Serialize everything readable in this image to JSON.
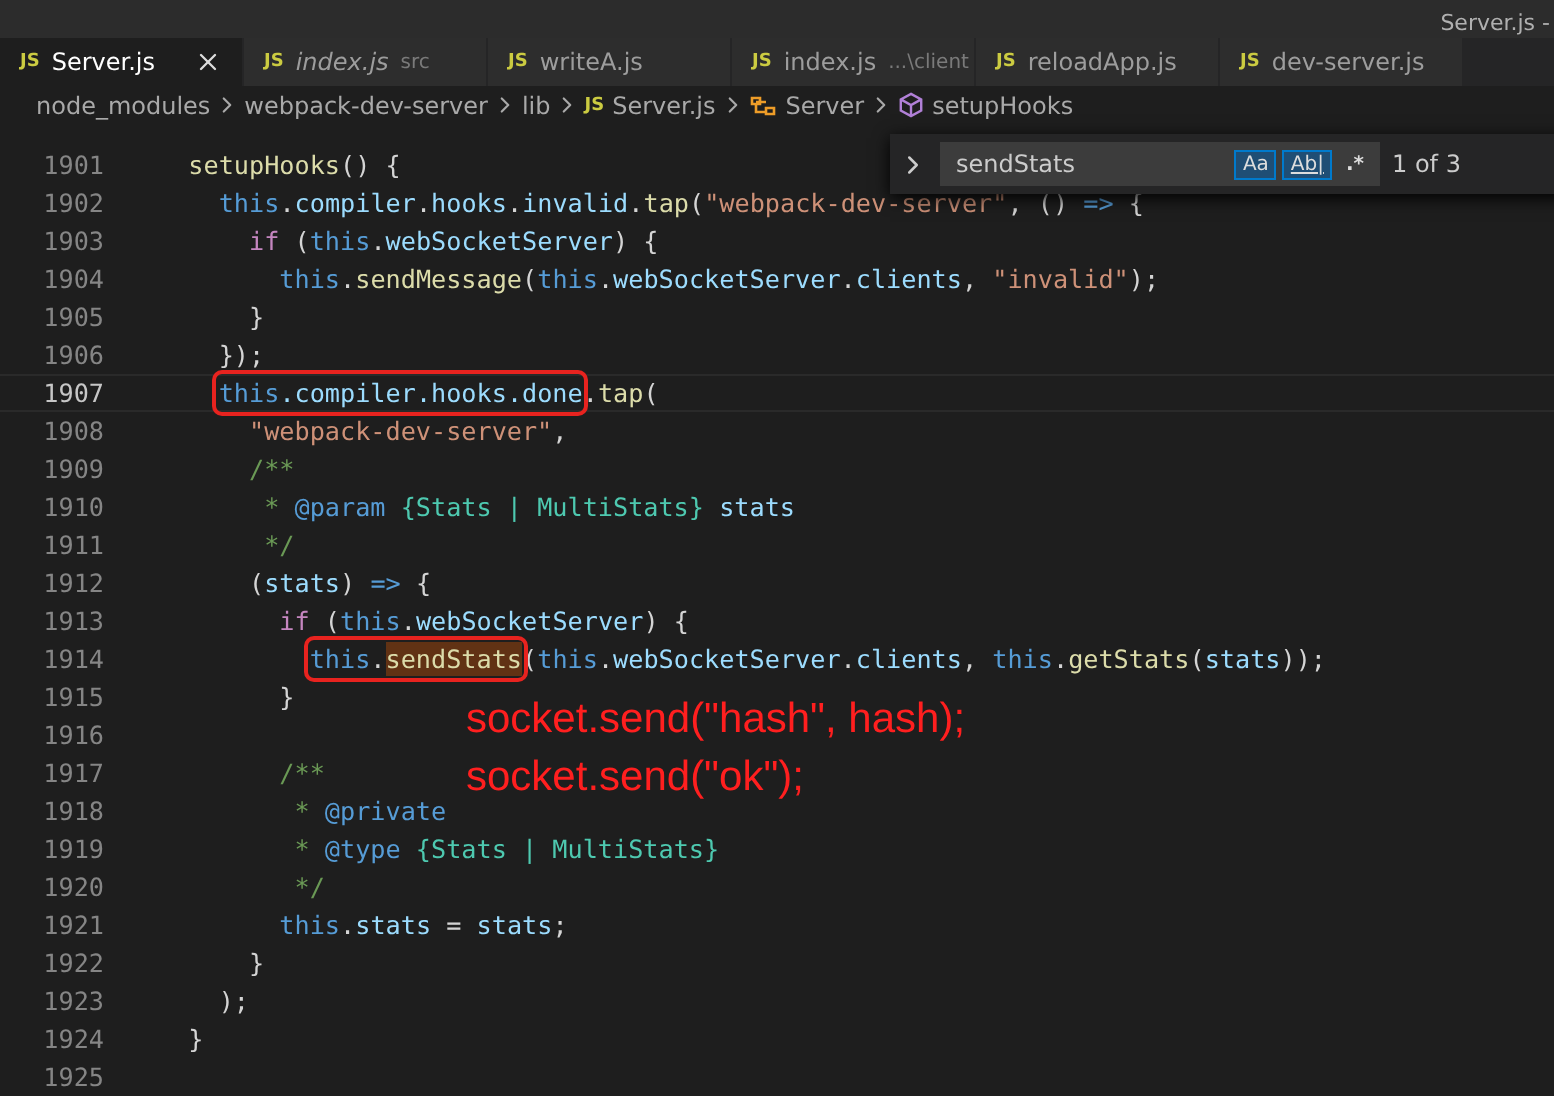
{
  "window": {
    "title": "Server.js -"
  },
  "tabs": [
    {
      "icon": "JS",
      "label": "Server.js",
      "selected": true,
      "italic": false,
      "closable": true
    },
    {
      "icon": "JS",
      "label": "index.js",
      "description": "src",
      "selected": false,
      "italic": true,
      "closable": false
    },
    {
      "icon": "JS",
      "label": "writeA.js",
      "selected": false,
      "italic": false,
      "closable": false
    },
    {
      "icon": "JS",
      "label": "index.js",
      "description": "...\\client",
      "selected": false,
      "italic": false,
      "closable": false
    },
    {
      "icon": "JS",
      "label": "reloadApp.js",
      "selected": false,
      "italic": false,
      "closable": false
    },
    {
      "icon": "JS",
      "label": "dev-server.js",
      "selected": false,
      "italic": false,
      "closable": false
    }
  ],
  "breadcrumbs": [
    {
      "kind": "folder",
      "label": "node_modules"
    },
    {
      "kind": "folder",
      "label": "webpack-dev-server"
    },
    {
      "kind": "folder",
      "label": "lib"
    },
    {
      "kind": "file",
      "icon": "JS",
      "label": "Server.js"
    },
    {
      "kind": "class",
      "label": "Server"
    },
    {
      "kind": "method",
      "label": "setupHooks"
    }
  ],
  "find": {
    "value": "sendStats",
    "toggles": [
      {
        "kind": "case",
        "label": "Aa",
        "selected": true
      },
      {
        "kind": "word",
        "label": "Ab|",
        "selected": true
      },
      {
        "kind": "regex",
        "label": ".*",
        "selected": false
      }
    ],
    "result": "1 of 3"
  },
  "lines": [
    {
      "number": "1901",
      "current": false,
      "tokens": [
        {
          "kind": "function",
          "text": "  setupHooks"
        },
        {
          "kind": "punctuation",
          "text": "() {"
        }
      ]
    },
    {
      "number": "1902",
      "current": false,
      "tokens": [
        {
          "kind": "keyword",
          "text": "    this"
        },
        {
          "kind": "punctuation",
          "text": "."
        },
        {
          "kind": "variable",
          "text": "compiler"
        },
        {
          "kind": "punctuation",
          "text": "."
        },
        {
          "kind": "variable",
          "text": "hooks"
        },
        {
          "kind": "punctuation",
          "text": "."
        },
        {
          "kind": "variable",
          "text": "invalid"
        },
        {
          "kind": "punctuation",
          "text": "."
        },
        {
          "kind": "function",
          "text": "tap"
        },
        {
          "kind": "punctuation",
          "text": "("
        },
        {
          "kind": "string",
          "text": "\"webpack-dev-server\""
        },
        {
          "kind": "punctuation",
          "text": ", ()"
        },
        {
          "kind": "keyword",
          "text": " =>"
        },
        {
          "kind": "punctuation",
          "text": " {"
        }
      ]
    },
    {
      "number": "1903",
      "current": false,
      "tokens": [
        {
          "kind": "control",
          "text": "      if"
        },
        {
          "kind": "punctuation",
          "text": " ("
        },
        {
          "kind": "keyword",
          "text": "this"
        },
        {
          "kind": "punctuation",
          "text": "."
        },
        {
          "kind": "variable",
          "text": "webSocketServer"
        },
        {
          "kind": "punctuation",
          "text": ") {"
        }
      ]
    },
    {
      "number": "1904",
      "current": false,
      "tokens": [
        {
          "kind": "keyword",
          "text": "        this"
        },
        {
          "kind": "punctuation",
          "text": "."
        },
        {
          "kind": "function",
          "text": "sendMessage"
        },
        {
          "kind": "punctuation",
          "text": "("
        },
        {
          "kind": "keyword",
          "text": "this"
        },
        {
          "kind": "punctuation",
          "text": "."
        },
        {
          "kind": "variable",
          "text": "webSocketServer"
        },
        {
          "kind": "punctuation",
          "text": "."
        },
        {
          "kind": "variable",
          "text": "clients"
        },
        {
          "kind": "punctuation",
          "text": ","
        },
        {
          "kind": "string",
          "text": " \"invalid\""
        },
        {
          "kind": "punctuation",
          "text": ");"
        }
      ]
    },
    {
      "number": "1905",
      "current": false,
      "tokens": [
        {
          "kind": "punctuation",
          "text": "      }"
        }
      ]
    },
    {
      "number": "1906",
      "current": false,
      "tokens": [
        {
          "kind": "punctuation",
          "text": "    });"
        }
      ]
    },
    {
      "number": "1907",
      "current": true,
      "tokens": [
        {
          "kind": "group",
          "boxed": true,
          "tokens": [
            {
              "kind": "keyword",
              "text": "    this"
            },
            {
              "kind": "variable",
              "text": ".compiler"
            },
            {
              "kind": "variable",
              "text": ".hooks"
            },
            {
              "kind": "variable",
              "text": ".done"
            }
          ]
        },
        {
          "kind": "punctuation",
          "text": "."
        },
        {
          "kind": "function",
          "text": "tap"
        },
        {
          "kind": "punctuation",
          "text": "("
        }
      ]
    },
    {
      "number": "1908",
      "current": false,
      "tokens": [
        {
          "kind": "string",
          "text": "      \"webpack-dev-server\""
        },
        {
          "kind": "punctuation",
          "text": ","
        }
      ]
    },
    {
      "number": "1909",
      "current": false,
      "tokens": [
        {
          "kind": "comment",
          "text": "      /**"
        }
      ]
    },
    {
      "number": "1910",
      "current": false,
      "tokens": [
        {
          "kind": "comment",
          "text": "       *"
        },
        {
          "kind": "keyword",
          "text": " @param"
        },
        {
          "kind": "type",
          "text": " {Stats | MultiStats}"
        },
        {
          "kind": "variable",
          "text": " stats"
        }
      ]
    },
    {
      "number": "1911",
      "current": false,
      "tokens": [
        {
          "kind": "comment",
          "text": "       */"
        }
      ]
    },
    {
      "number": "1912",
      "current": false,
      "tokens": [
        {
          "kind": "punctuation",
          "text": "      ("
        },
        {
          "kind": "variable",
          "text": "stats"
        },
        {
          "kind": "punctuation",
          "text": ")"
        },
        {
          "kind": "keyword",
          "text": " =>"
        },
        {
          "kind": "punctuation",
          "text": " {"
        }
      ]
    },
    {
      "number": "1913",
      "current": false,
      "tokens": [
        {
          "kind": "control",
          "text": "        if"
        },
        {
          "kind": "punctuation",
          "text": " ("
        },
        {
          "kind": "keyword",
          "text": "this"
        },
        {
          "kind": "punctuation",
          "text": "."
        },
        {
          "kind": "variable",
          "text": "webSocketServer"
        },
        {
          "kind": "punctuation",
          "text": ") {"
        }
      ]
    },
    {
      "number": "1914",
      "current": false,
      "tokens": [
        {
          "kind": "group",
          "boxed": true,
          "tokens": [
            {
              "kind": "keyword",
              "text": "          this"
            },
            {
              "kind": "punctuation",
              "text": "."
            },
            {
              "kind": "function",
              "text": "sendStats",
              "match": true
            }
          ]
        },
        {
          "kind": "punctuation",
          "text": "("
        },
        {
          "kind": "keyword",
          "text": "this"
        },
        {
          "kind": "punctuation",
          "text": "."
        },
        {
          "kind": "variable",
          "text": "webSocketServer"
        },
        {
          "kind": "punctuation",
          "text": "."
        },
        {
          "kind": "variable",
          "text": "clients"
        },
        {
          "kind": "punctuation",
          "text": ","
        },
        {
          "kind": "keyword",
          "text": " this"
        },
        {
          "kind": "punctuation",
          "text": "."
        },
        {
          "kind": "function",
          "text": "getStats"
        },
        {
          "kind": "punctuation",
          "text": "("
        },
        {
          "kind": "variable",
          "text": "stats"
        },
        {
          "kind": "punctuation",
          "text": "));"
        }
      ]
    },
    {
      "number": "1915",
      "current": false,
      "tokens": [
        {
          "kind": "punctuation",
          "text": "        }"
        }
      ]
    },
    {
      "number": "1916",
      "current": false
    },
    {
      "number": "1917",
      "current": false,
      "tokens": [
        {
          "kind": "comment",
          "text": "        /**"
        }
      ]
    },
    {
      "number": "1918",
      "current": false,
      "tokens": [
        {
          "kind": "comment",
          "text": "         *"
        },
        {
          "kind": "keyword",
          "text": " @private"
        }
      ]
    },
    {
      "number": "1919",
      "current": false,
      "tokens": [
        {
          "kind": "comment",
          "text": "         *"
        },
        {
          "kind": "keyword",
          "text": " @type"
        },
        {
          "kind": "type",
          "text": " {Stats | MultiStats}"
        }
      ]
    },
    {
      "number": "1920",
      "current": false,
      "tokens": [
        {
          "kind": "comment",
          "text": "         */"
        }
      ]
    },
    {
      "number": "1921",
      "current": false,
      "tokens": [
        {
          "kind": "keyword",
          "text": "        this"
        },
        {
          "kind": "punctuation",
          "text": "."
        },
        {
          "kind": "variable",
          "text": "stats"
        },
        {
          "kind": "punctuation",
          "text": " ="
        },
        {
          "kind": "variable",
          "text": " stats"
        },
        {
          "kind": "punctuation",
          "text": ";"
        }
      ]
    },
    {
      "number": "1922",
      "current": false,
      "tokens": [
        {
          "kind": "punctuation",
          "text": "      }"
        }
      ]
    },
    {
      "number": "1923",
      "current": false,
      "tokens": [
        {
          "kind": "punctuation",
          "text": "    );"
        }
      ]
    },
    {
      "number": "1924",
      "current": false,
      "tokens": [
        {
          "kind": "punctuation",
          "text": "  }"
        }
      ]
    },
    {
      "number": "1925",
      "current": false
    }
  ],
  "annotation": [
    "socket.send(\"hash\", hash);",
    "socket.send(\"ok\");"
  ]
}
